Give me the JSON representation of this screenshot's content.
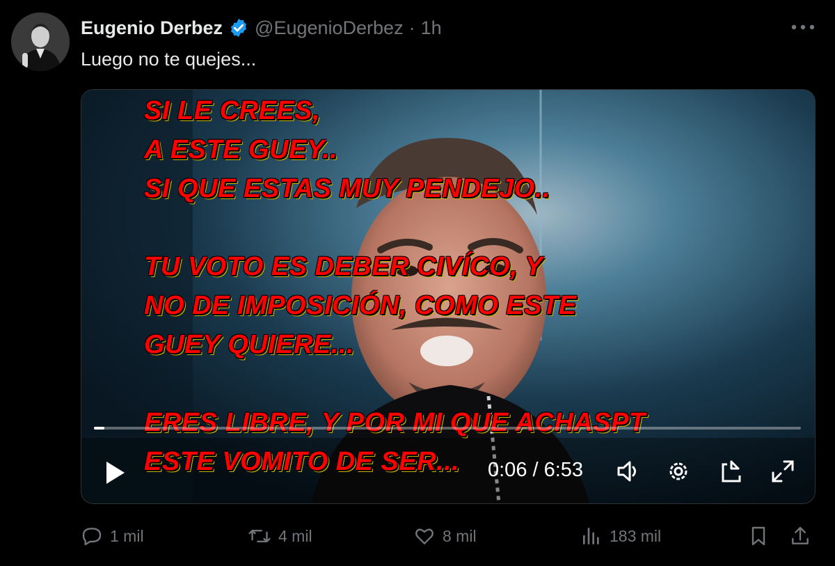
{
  "tweet": {
    "author_name": "Eugenio Derbez",
    "handle": "@EugenioDerbez",
    "separator": "·",
    "time_ago": "1h",
    "text": "Luego no te quejes..."
  },
  "video": {
    "overlay_lines": [
      "SI LE CREES,",
      "A ESTE GUEY..",
      "SI QUE ESTAS MUY PENDEJO..",
      "",
      "TU VOTO ES DEBER CIVÍCO, Y",
      "NO DE IMPOSICIÓN, COMO ESTE",
      "GUEY QUIERE...",
      "",
      "ERES LIBRE, Y POR MI QUE ACHASPT",
      "ESTE VOMITO DE SER..."
    ],
    "time_display": "0:06 / 6:53",
    "current_time": "0:06",
    "duration": "6:53",
    "progress_fraction": 0.015
  },
  "actions": {
    "replies": "1 mil",
    "reposts": "4 mil",
    "likes": "8 mil",
    "views": "183 mil"
  },
  "icons": {
    "verified": "verified-badge-icon",
    "more": "more-options-icon",
    "play": "play-icon",
    "volume": "volume-icon",
    "settings": "settings-gear-icon",
    "pip": "picture-in-picture-icon",
    "fullscreen": "fullscreen-icon",
    "reply": "reply-icon",
    "repost": "repost-icon",
    "like": "like-heart-icon",
    "views": "views-chart-icon",
    "bookmark": "bookmark-icon",
    "share": "share-icon"
  },
  "colors": {
    "background": "#000000",
    "text_primary": "#e7e9ea",
    "text_secondary": "#71767b",
    "verified_blue": "#1d9bf0",
    "overlay_red": "#ff0000",
    "overlay_outline": "#c6b400"
  }
}
